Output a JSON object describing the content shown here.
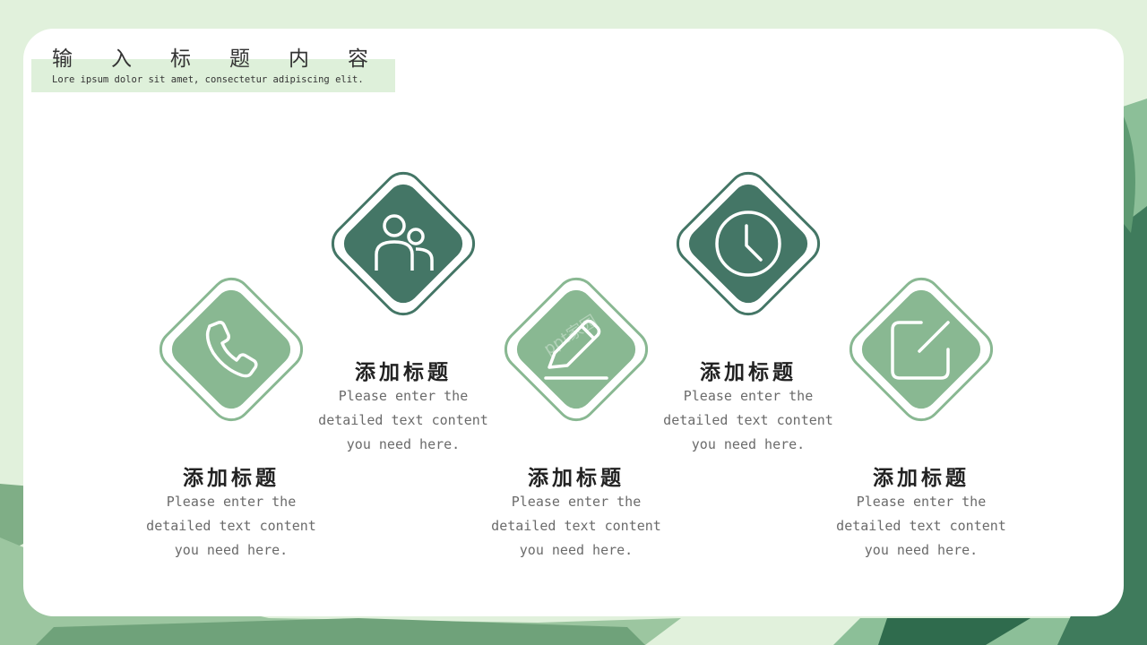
{
  "header": {
    "title": "输入标题内容",
    "subtitle": "Lore ipsum dolor sit amet, consectetur adipiscing elit."
  },
  "watermark": "ppt家园",
  "colors": {
    "dark_green": "#447666",
    "light_green": "#89b892",
    "band": "#def0da"
  },
  "items": [
    {
      "icon": "phone-icon",
      "title": "添加标题",
      "text": "Please enter the detailed text content you need here."
    },
    {
      "icon": "users-icon",
      "title": "添加标题",
      "text": "Please enter the detailed text content you need here."
    },
    {
      "icon": "pencil-icon",
      "title": "添加标题",
      "text": "Please enter the detailed text content you need here."
    },
    {
      "icon": "clock-icon",
      "title": "添加标题",
      "text": "Please enter the detailed text content you need here."
    },
    {
      "icon": "edit-icon",
      "title": "添加标题",
      "text": "Please enter the detailed text content you need here."
    }
  ]
}
